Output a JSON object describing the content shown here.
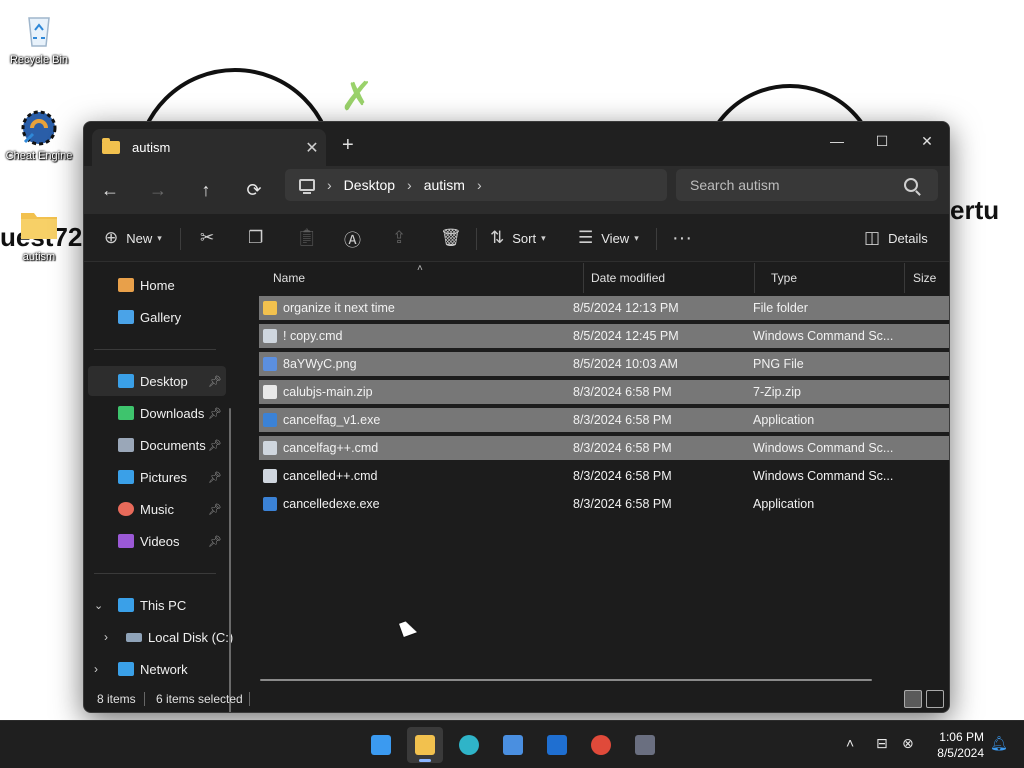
{
  "desktop": {
    "icons": [
      {
        "label": "Recycle Bin",
        "icon": "recycle-bin-icon"
      },
      {
        "label": "Cheat Engine",
        "icon": "cheat-engine-icon"
      },
      {
        "label": "autism",
        "icon": "folder-icon"
      }
    ],
    "bg_text_left": "uest72",
    "bg_text_right": "ertu"
  },
  "window": {
    "tab_title": "autism",
    "new_tab_glyph": "+",
    "controls": {
      "minimize": "—",
      "maximize": "☐",
      "close": "✕"
    }
  },
  "nav": {
    "back": "←",
    "forward": "→",
    "up": "↑",
    "refresh": "⟳",
    "breadcrumb": [
      "Desktop",
      "autism"
    ],
    "search_placeholder": "Search autism"
  },
  "commandbar": {
    "new_label": "New",
    "sort_label": "Sort",
    "view_label": "View",
    "more_label": "···",
    "details_label": "Details"
  },
  "sidebar": {
    "items": [
      {
        "label": "Home",
        "icon": "home-icon",
        "color": "#e8a04a"
      },
      {
        "label": "Gallery",
        "icon": "gallery-icon",
        "color": "#4aa3e8"
      },
      {
        "label": "Desktop",
        "icon": "desktop-icon",
        "color": "#3aa0e8",
        "pinned": true,
        "selected": true
      },
      {
        "label": "Downloads",
        "icon": "downloads-icon",
        "color": "#3ec46d",
        "pinned": true
      },
      {
        "label": "Documents",
        "icon": "documents-icon",
        "color": "#9aa7b8",
        "pinned": true
      },
      {
        "label": "Pictures",
        "icon": "pictures-icon",
        "color": "#3aa0e8",
        "pinned": true
      },
      {
        "label": "Music",
        "icon": "music-icon",
        "color": "#e86a5a",
        "pinned": true
      },
      {
        "label": "Videos",
        "icon": "videos-icon",
        "color": "#9b59d6",
        "pinned": true
      },
      {
        "label": "This PC",
        "icon": "this-pc-icon",
        "color": "#3aa0e8",
        "expanded": true
      },
      {
        "label": "Local Disk (C:)",
        "icon": "disk-icon",
        "color": "#8fa3b8"
      },
      {
        "label": "Network",
        "icon": "network-icon",
        "color": "#3aa0e8"
      }
    ]
  },
  "columns": [
    "Name",
    "Date modified",
    "Type",
    "Size"
  ],
  "files": [
    {
      "name": "organize it next time",
      "date": "8/5/2024 12:13 PM",
      "type": "File folder",
      "icon": "folder-icon",
      "color": "#f2c14e",
      "selected": true
    },
    {
      "name": "! copy.cmd",
      "date": "8/5/2024 12:45 PM",
      "type": "Windows Command Sc...",
      "icon": "cmd-file-icon",
      "color": "#cfd6de",
      "selected": true
    },
    {
      "name": "8aYWyC.png",
      "date": "8/5/2024 10:03 AM",
      "type": "PNG File",
      "icon": "image-file-icon",
      "color": "#5b8fe0",
      "selected": true
    },
    {
      "name": "calubjs-main.zip",
      "date": "8/3/2024 6:58 PM",
      "type": "7-Zip.zip",
      "icon": "zip-file-icon",
      "color": "#e8e8e8",
      "selected": true
    },
    {
      "name": "cancelfag_v1.exe",
      "date": "8/3/2024 6:58 PM",
      "type": "Application",
      "icon": "exe-file-icon",
      "color": "#3b82d6",
      "selected": true
    },
    {
      "name": "cancelfag++.cmd",
      "date": "8/3/2024 6:58 PM",
      "type": "Windows Command Sc...",
      "icon": "cmd-file-icon",
      "color": "#cfd6de",
      "selected": true
    },
    {
      "name": "cancelled++.cmd",
      "date": "8/3/2024 6:58 PM",
      "type": "Windows Command Sc...",
      "icon": "cmd-file-icon",
      "color": "#cfd6de",
      "selected": false
    },
    {
      "name": "cancelledexe.exe",
      "date": "8/3/2024 6:58 PM",
      "type": "Application",
      "icon": "exe-file-icon",
      "color": "#3b82d6",
      "selected": false
    }
  ],
  "status": {
    "items": "8 items",
    "selected": "6 items selected"
  },
  "taskbar": {
    "apps": [
      {
        "name": "start-button",
        "color": "#3b9af0"
      },
      {
        "name": "file-explorer",
        "color": "#f2c14e",
        "active": true
      },
      {
        "name": "edge",
        "color": "#2fb4c8"
      },
      {
        "name": "store",
        "color": "#4a8fe0"
      },
      {
        "name": "outlook",
        "color": "#1f6fd1"
      },
      {
        "name": "chrome",
        "color": "#e04a3a"
      },
      {
        "name": "game",
        "color": "#6a6f80"
      }
    ],
    "time": "1:06 PM",
    "date": "8/5/2024"
  }
}
